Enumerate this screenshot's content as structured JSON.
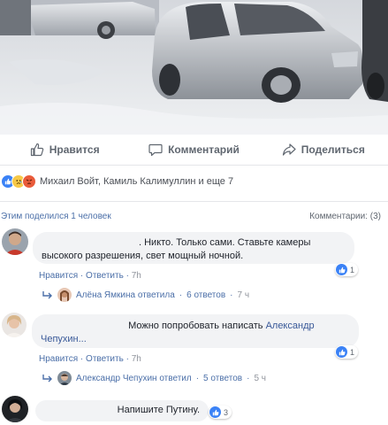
{
  "actions": {
    "like_label": "Нравится",
    "comment_label": "Комментарий",
    "share_label": "Поделиться"
  },
  "reactions": {
    "names": "Михаил Войт, Камиль Калимуллин и еще 7",
    "icons": [
      "like-icon",
      "sad-icon",
      "angry-icon"
    ]
  },
  "meta": {
    "shares": "Этим поделился 1 человек",
    "comments": "Комментарии: (3)"
  },
  "comments": [
    {
      "text": ". Никто. Только сами. Ставьте камеры высокого разрешения, свет мощный ночной.",
      "likes": "1",
      "like_label": "Нравится",
      "reply_label": "Ответить",
      "time": "7h",
      "replies": {
        "author": "Алёна Ямкина ответила",
        "count": "6 ответов",
        "time": "7 ч"
      }
    },
    {
      "text_prefix": "Можно попробовать написать",
      "mention": "Александр Чепухин...",
      "likes": "1",
      "like_label": "Нравится",
      "reply_label": "Ответить",
      "time": "7h",
      "replies": {
        "author": "Александр Чепухин ответил",
        "count": "5 ответов",
        "time": "5 ч"
      }
    },
    {
      "text": "Напишите Путину.",
      "likes": "3"
    }
  ],
  "separator": "·",
  "colors": {
    "link": "#4b6fa8",
    "like_blue": "#3b82f6",
    "bubble": "#f2f3f5",
    "text": "#1d2129"
  }
}
